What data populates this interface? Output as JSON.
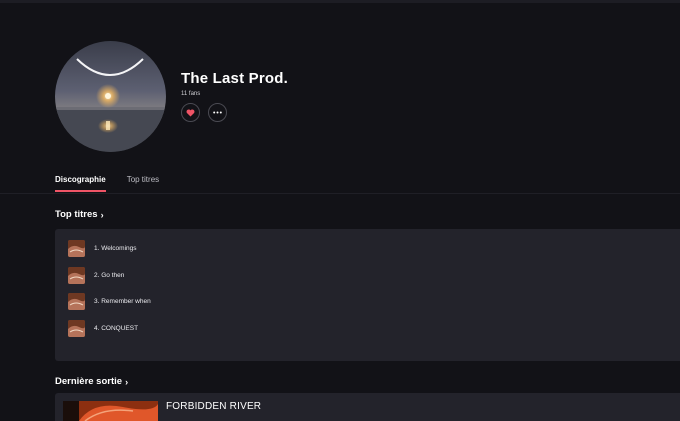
{
  "artist": {
    "name": "The Last Prod.",
    "fans": "11 fans"
  },
  "tabs": [
    {
      "label": "Discographie",
      "active": true
    },
    {
      "label": "Top titres",
      "active": false
    }
  ],
  "top_tracks": {
    "title": "Top titres",
    "items": [
      {
        "label": "1. Welcomings"
      },
      {
        "label": "2. Go then"
      },
      {
        "label": "3. Remember when"
      },
      {
        "label": "4. CONQUEST"
      }
    ]
  },
  "latest_release": {
    "title": "Dernière sortie",
    "item_title": "FORBIDDEN RIVER"
  },
  "colors": {
    "background": "#121217",
    "panel": "#23232b",
    "accent": "#ef5466"
  },
  "icons": {
    "favorite": "heart-icon",
    "more": "more-dots-icon",
    "chevron": "chevron-right-icon"
  }
}
